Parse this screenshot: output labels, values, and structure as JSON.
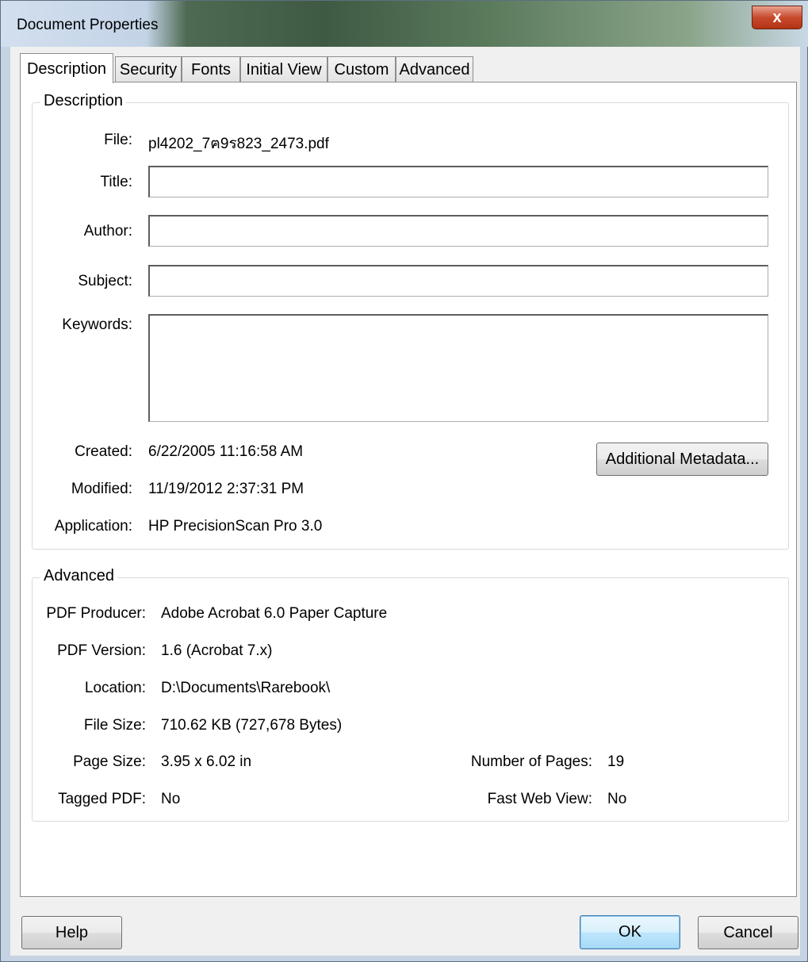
{
  "window": {
    "title": "Document Properties",
    "close_symbol": "x"
  },
  "tabs": [
    {
      "label": "Description",
      "active": true
    },
    {
      "label": "Security",
      "active": false
    },
    {
      "label": "Fonts",
      "active": false
    },
    {
      "label": "Initial View",
      "active": false
    },
    {
      "label": "Custom",
      "active": false
    },
    {
      "label": "Advanced",
      "active": false
    }
  ],
  "description": {
    "group_label": "Description",
    "file_label": "File:",
    "file_value": "pl4202_7ฅ9ร823_2473.pdf",
    "title_label": "Title:",
    "title_value": "",
    "author_label": "Author:",
    "author_value": "",
    "subject_label": "Subject:",
    "subject_value": "",
    "keywords_label": "Keywords:",
    "keywords_value": "",
    "created_label": "Created:",
    "created_value": "6/22/2005 11:16:58 AM",
    "modified_label": "Modified:",
    "modified_value": "11/19/2012 2:37:31 PM",
    "application_label": "Application:",
    "application_value": "HP PrecisionScan Pro 3.0",
    "metadata_button": "Additional Metadata..."
  },
  "advanced": {
    "group_label": "Advanced",
    "producer_label": "PDF Producer:",
    "producer_value": "Adobe Acrobat 6.0 Paper Capture",
    "version_label": "PDF Version:",
    "version_value": "1.6 (Acrobat 7.x)",
    "location_label": "Location:",
    "location_value": "D:\\Documents\\Rarebook\\",
    "filesize_label": "File Size:",
    "filesize_value": "710.62 KB (727,678 Bytes)",
    "pagesize_label": "Page Size:",
    "pagesize_value": "3.95 x 6.02 in",
    "numpages_label": "Number of Pages:",
    "numpages_value": "19",
    "tagged_label": "Tagged PDF:",
    "tagged_value": "No",
    "fastweb_label": "Fast Web View:",
    "fastweb_value": "No"
  },
  "footer": {
    "help": "Help",
    "ok": "OK",
    "cancel": "Cancel"
  },
  "colors": {
    "window_frame": "#c5d3e4",
    "close_button": "#c84a2d",
    "default_button_border": "#3c7fb1"
  }
}
